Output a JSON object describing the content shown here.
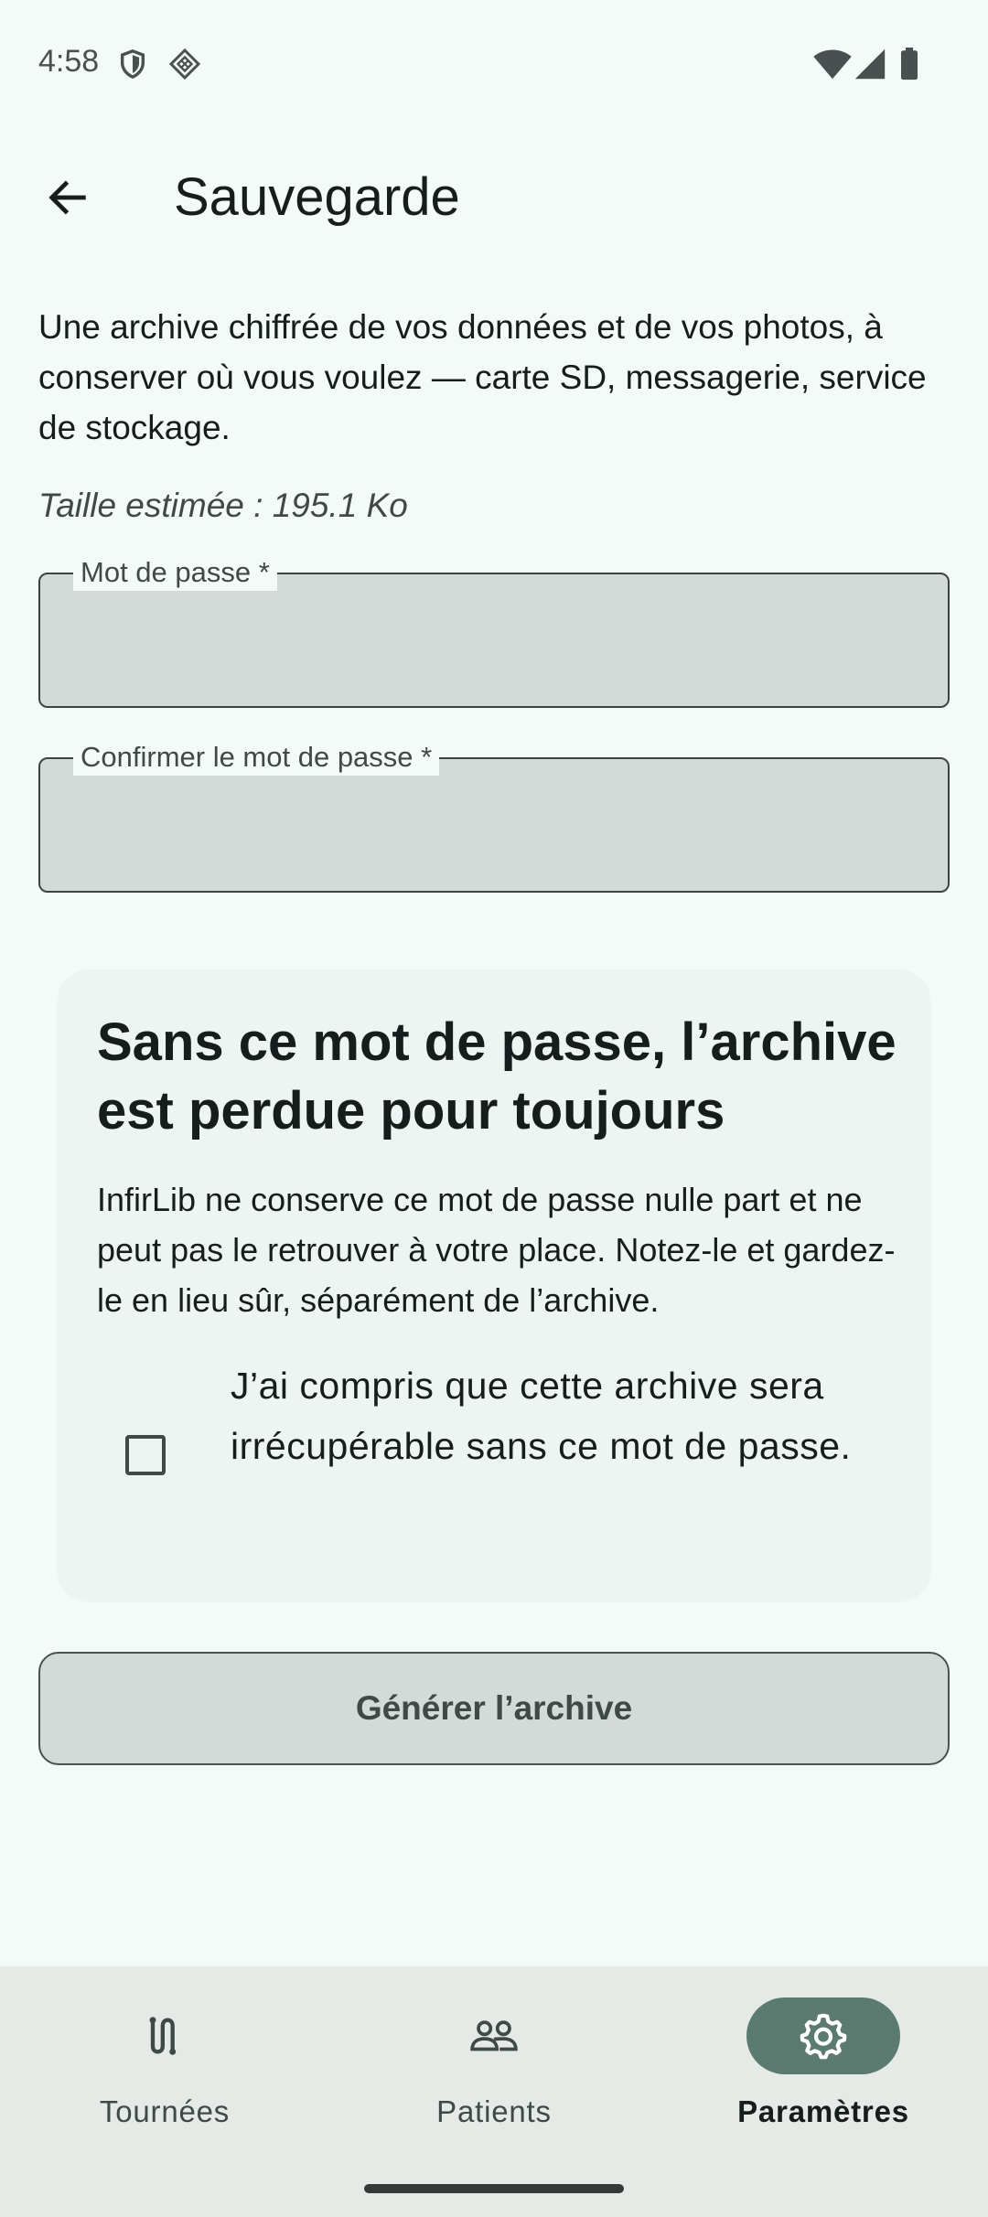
{
  "status_bar": {
    "time": "4:58",
    "icons": [
      "shield-icon",
      "diamond-grid-icon",
      "wifi-icon",
      "cell-signal-icon",
      "battery-icon"
    ]
  },
  "app_bar": {
    "title": "Sauvegarde",
    "back_icon": "arrow-back-icon"
  },
  "intro_text": "Une archive chiffrée de vos données et de vos photos, à conserver où vous voulez — carte SD, messagerie, service de stockage.",
  "size_estimate": "Taille estimée : 195.1 Ko",
  "fields": {
    "password": {
      "label": "Mot de passe *",
      "value": ""
    },
    "confirm": {
      "label": "Confirmer le mot de passe *",
      "value": ""
    }
  },
  "warning_card": {
    "title": "Sans ce mot de passe, l’archive est perdue pour toujours",
    "body": "InfirLib ne conserve ce mot de passe nulle part et ne peut pas le retrouver à votre place. Notez-le et gardez-le en lieu sûr, séparément de l’archive.",
    "checkbox_label": "J’ai compris que cette archive sera irrécupérable sans ce mot de passe.",
    "checked": false
  },
  "generate_button": "Générer l’archive",
  "bottom_nav": {
    "items": [
      {
        "label": "Tournées",
        "icon": "route-icon",
        "active": false
      },
      {
        "label": "Patients",
        "icon": "people-icon",
        "active": false
      },
      {
        "label": "Paramètres",
        "icon": "gear-icon",
        "active": true
      }
    ]
  },
  "colors": {
    "background": "#f3fbf8",
    "active_pill": "#5b7b71",
    "field_fill": "#d3dad7",
    "nav_background": "#e5eae7"
  }
}
